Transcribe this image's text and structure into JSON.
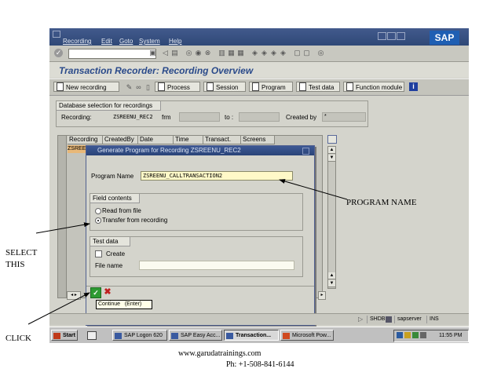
{
  "menu": {
    "items": [
      "Recording",
      "Edit",
      "Goto",
      "System",
      "Help"
    ],
    "logo": "SAP"
  },
  "title": "Transaction Recorder: Recording Overview",
  "app_toolbar": {
    "new_recording": "New recording",
    "process": "Process",
    "session": "Session",
    "program": "Program",
    "test_data": "Test data",
    "function_module": "Function module"
  },
  "db_selection": {
    "title": "Database selection for recordings",
    "recording_label": "Recording:",
    "recording_value": "ZSREENU_REC2",
    "from_label": "frm",
    "to_label": "to :",
    "created_by_label": "Created by",
    "created_by_value": "*"
  },
  "table": {
    "columns": [
      "Recording",
      "CreatedBy",
      "Date",
      "Time",
      "Transact.",
      "Screens"
    ],
    "first_cell": "ZSREE"
  },
  "dialog": {
    "title": "Generate Program for Recording ZSREENU_REC2",
    "program_name_label": "Program Name",
    "program_name_value": "ZSREENU_CALLTRANSACTION2",
    "field_contents_title": "Field contents",
    "read_from_file": "Read from file",
    "transfer_from_recording": "Transfer from recording",
    "test_data_title": "Test data",
    "create_label": "Create",
    "file_name_label": "File name",
    "continue_tooltip": "Continue   (Enter)"
  },
  "status_bar": {
    "tcode": "SHDB",
    "server": "sapserver",
    "mode": "INS"
  },
  "taskbar": {
    "start": "Start",
    "tasks": [
      "SAP Logon 620",
      "SAP Easy Acc...",
      "Transaction...",
      "Microsoft Pow..."
    ],
    "clock": "11:55 PM"
  },
  "annotations": {
    "program_name": "PROGRAM NAME",
    "select_this_1": "SELECT",
    "select_this_2": "THIS",
    "click": "CLICK"
  },
  "footer": {
    "website": "www.garudatrainings.com",
    "phone": "Ph: +1-508-841-6144"
  },
  "colors": {
    "title_blue": "#2a4a8a",
    "menubar_blue": "#2f4877",
    "input_yellow": "#fff9c8"
  }
}
